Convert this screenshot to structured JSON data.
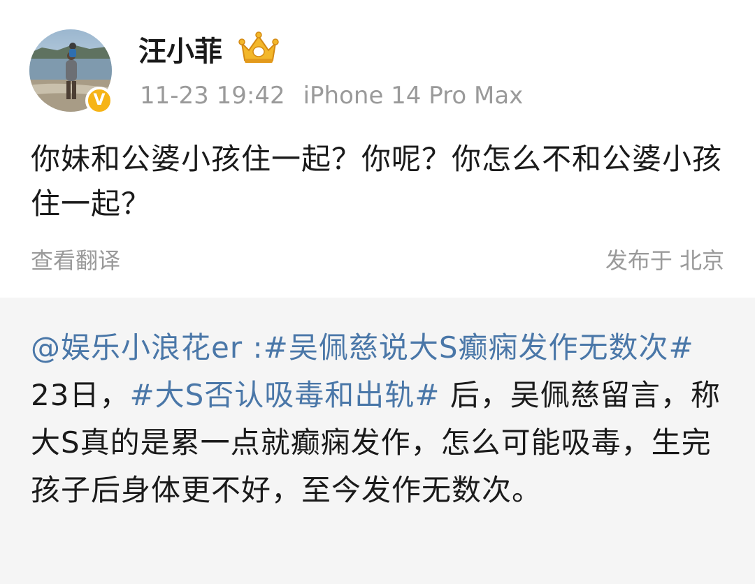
{
  "post": {
    "username": "汪小菲",
    "verified_icon": "verified-v-badge",
    "verified_label": "V",
    "membership_icon": "crown-icon",
    "timestamp": "11-23 19:42",
    "device": "iPhone 14 Pro Max",
    "text": "你妹和公婆小孩住一起？你呢？你怎么不和公婆小孩住一起？",
    "translate_label": "查看翻译",
    "location_label": "发布于 北京"
  },
  "repost": {
    "author": "@娱乐小浪花er",
    "separator": " :",
    "hashtag1": "#吴佩慈说大S癫痫发作无数次#",
    "text_part1": " 23日，",
    "hashtag2": "#大S否认吸毒和出轨#",
    "text_part2": " 后，吴佩慈留言，称大S真的是累一点就癫痫发作，怎么可能吸毒，生完孩子后身体更不好，至今发作无数次。"
  },
  "colors": {
    "link": "#4a77a8",
    "badge": "#f6b417",
    "meta_text": "#9a9a9a",
    "repost_bg": "#f5f5f5"
  }
}
